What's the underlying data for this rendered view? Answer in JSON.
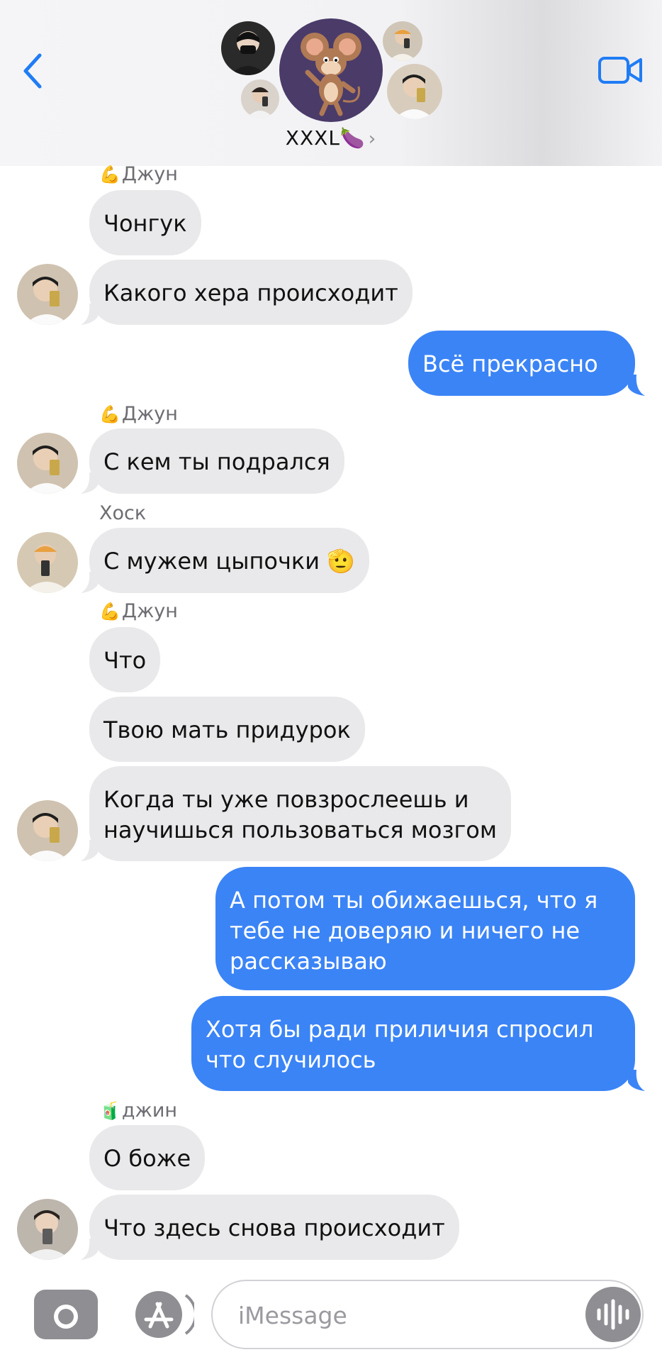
{
  "header": {
    "group_name": "XXXL🍆",
    "chevron": "›",
    "icons": [
      "chevron-left-icon",
      "video-camera-icon"
    ]
  },
  "messages": [
    {
      "sender": "Джун",
      "sender_emoji": "💪",
      "text": "Чонгук",
      "dir": "in"
    },
    {
      "text": "Какого хера происходит",
      "dir": "in"
    },
    {
      "text": "Всё прекрасно",
      "dir": "out"
    },
    {
      "sender": "Джун",
      "sender_emoji": "💪",
      "text": "С кем ты подрался",
      "dir": "in"
    },
    {
      "sender": "Хоск",
      "text": "С мужем цыпочки 🫡",
      "dir": "in"
    },
    {
      "sender": "Джун",
      "sender_emoji": "💪",
      "text": "Что",
      "dir": "in"
    },
    {
      "text": "Твою мать придурок",
      "dir": "in"
    },
    {
      "text": "Когда ты уже повзрослеешь и\nнаучишься пользоваться мозгом",
      "dir": "in"
    },
    {
      "text": "А потом ты обижаешься, что я\nтебе не доверяю и ничего не\nрассказываю",
      "dir": "out"
    },
    {
      "text": "Хотя бы ради приличия спросил\nчто случилось",
      "dir": "out"
    },
    {
      "sender": "джин",
      "sender_emoji": "🧃",
      "text": "О боже",
      "dir": "in"
    },
    {
      "text": "Что здесь снова происходит",
      "dir": "in"
    }
  ],
  "input": {
    "placeholder": "iMessage",
    "value": ""
  },
  "colors": {
    "outgoing": "#3b84f6",
    "incoming": "#e9e9eb",
    "accent": "#1f7cf5"
  }
}
